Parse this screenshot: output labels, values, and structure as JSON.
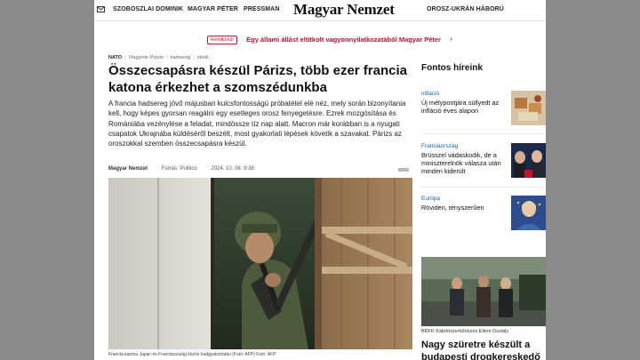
{
  "nav": {
    "items": [
      "SZOBOSZLAI DOMINIK",
      "MAGYAR PÉTER",
      "PRESSMAN"
    ],
    "logo": "Magyar Nemzet",
    "right_item": "OROSZ-UKRÁN HÁBORÚ"
  },
  "breaking": {
    "badge": "Rendkívüli",
    "text": "Egy állami állást eltitkolt vagyonnyilatkozatából Magyar Péter",
    "chevron": "›"
  },
  "article": {
    "tags": [
      "NATO",
      "Vlagyimir Putyin",
      "hadsereg",
      "elnök"
    ],
    "headline": "Összecsapásra készül Párizs, több ezer francia katona érkezhet a szomszédunkba",
    "lead": "A francia hadsereg jövő májusban kulcsfontosságú próbatétel elé néz, mely során bizonyítania kell, hogy képes gyorsan reagálni egy esetleges orosz fenyegetésre. Ezrek mozgósítása és Romániába vezénylése a feladat, mindössze tíz nap alatt. Macron már korábban is a nyugati csapatok Ukrajnába küldéséről beszélt, most gyakorlati lépések követik a szavakat. Párizs az oroszokkal szemben összecsapásra készül.",
    "author": "Magyar Nemzet",
    "source": "Forrás: Politico",
    "date": "2024. 10. 08. 9:38",
    "caption": "Francia katona Japán és Franciaország közös hadgyakorlatán (Fotó: AFP) Fotó: AFP"
  },
  "sidebar": {
    "title": "Fontos híreink",
    "items": [
      {
        "category": "infláció",
        "title": "Új mélypontjára süllyedt az infláció éves alapon"
      },
      {
        "category": "Franciaország",
        "title": "Brüsszel vádaskodik, de a miniszterelnök válasza után minden kiderült"
      },
      {
        "category": "Európa",
        "title": "Röviden, tényszerűen"
      }
    ],
    "big_caption": "BRFK Kábítószerbűnözés Elleni Osztály",
    "big_title": "Nagy szüretre készült a budapesti drogkereskedő"
  },
  "colors": {
    "accent_red": "#c8102e",
    "category_blue": "#1a5fa8"
  },
  "icons": [
    "mail-icon",
    "chevron-right-icon",
    "share-icon"
  ]
}
